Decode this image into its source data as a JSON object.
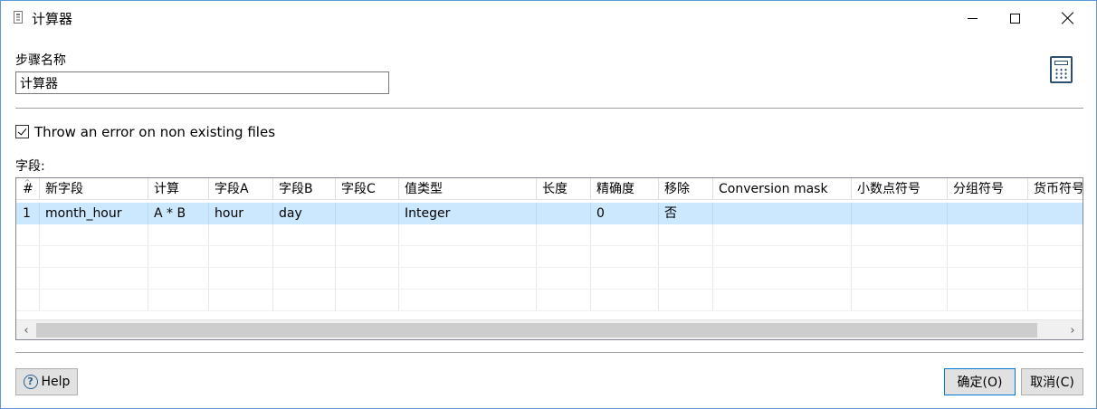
{
  "window": {
    "title": "计算器",
    "icon": "document-icon",
    "controls": {
      "minimize": "minimize-icon",
      "maximize": "maximize-icon",
      "close": "close-icon"
    }
  },
  "step": {
    "label": "步骤名称",
    "value": "计算器",
    "icon": "calculator-icon"
  },
  "options": {
    "throw_error_label": "Throw an error on non existing files",
    "throw_error_checked": true
  },
  "fields": {
    "label": "字段:",
    "columns": [
      "#",
      "新字段",
      "计算",
      "字段A",
      "字段B",
      "字段C",
      "值类型",
      "长度",
      "精确度",
      "移除",
      "Conversion mask",
      "小数点符号",
      "分组符号",
      "货币符号"
    ],
    "rows": [
      [
        "1",
        "month_hour",
        "A * B",
        "hour",
        "day",
        "",
        "Integer",
        "",
        "0",
        "否",
        "",
        "",
        "",
        ""
      ]
    ],
    "scroll_left": "‹",
    "scroll_right": "›"
  },
  "buttons": {
    "help": "Help",
    "ok": "确定(O)",
    "cancel": "取消(C)"
  },
  "colors": {
    "selected_row": "#cce8ff",
    "window_border": "#5a9bd5",
    "button_face": "#e1e1e1",
    "default_button_border": "#0078d7"
  }
}
